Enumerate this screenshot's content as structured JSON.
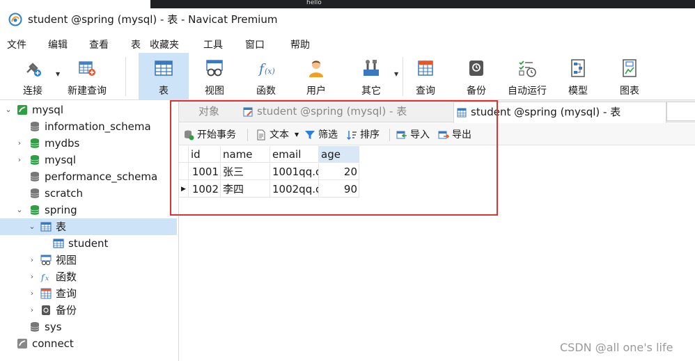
{
  "window": {
    "title": "student @spring (mysql) - 表 - Navicat Premium",
    "background_tab": "hello"
  },
  "menu": [
    "文件",
    "编辑",
    "查看",
    "表",
    "收藏夹",
    "工具",
    "窗口",
    "帮助"
  ],
  "toolbar": [
    {
      "label": "连接",
      "icon": "connection-plug-icon"
    },
    {
      "label": "新建查询",
      "icon": "new-query-icon"
    },
    {
      "label": "表",
      "icon": "table-icon",
      "active": true
    },
    {
      "label": "视图",
      "icon": "view-icon"
    },
    {
      "label": "函数",
      "icon": "function-icon"
    },
    {
      "label": "用户",
      "icon": "user-icon"
    },
    {
      "label": "其它",
      "icon": "tools-icon"
    },
    {
      "label": "查询",
      "icon": "query-icon"
    },
    {
      "label": "备份",
      "icon": "backup-icon"
    },
    {
      "label": "自动运行",
      "icon": "automation-icon"
    },
    {
      "label": "模型",
      "icon": "model-icon"
    },
    {
      "label": "图表",
      "icon": "chart-icon"
    }
  ],
  "tree": [
    {
      "label": "mysql",
      "icon": "connection-icon",
      "expanded": true
    },
    {
      "label": "information_schema",
      "icon": "database-icon"
    },
    {
      "label": "mydbs",
      "icon": "database-icon"
    },
    {
      "label": "mysql",
      "icon": "database-icon"
    },
    {
      "label": "performance_schema",
      "icon": "database-icon"
    },
    {
      "label": "scratch",
      "icon": "database-icon"
    },
    {
      "label": "spring",
      "icon": "database-icon",
      "expanded": true
    },
    {
      "label": "表",
      "icon": "table-icon",
      "expanded": true,
      "selected": true
    },
    {
      "label": "student",
      "icon": "table-icon"
    },
    {
      "label": "视图",
      "icon": "view-icon"
    },
    {
      "label": "函数",
      "icon": "function-icon"
    },
    {
      "label": "查询",
      "icon": "query-icon"
    },
    {
      "label": "备份",
      "icon": "backup-icon"
    },
    {
      "label": "sys",
      "icon": "database-icon"
    },
    {
      "label": "connect",
      "icon": "connection-icon"
    }
  ],
  "tabs": [
    {
      "label": "对象"
    },
    {
      "label": "student @spring (mysql) - 表"
    },
    {
      "label": "student @spring (mysql) - 表",
      "active": true
    }
  ],
  "object_toolbar": {
    "begin_transaction": "开始事务",
    "text": "文本",
    "filter": "筛选",
    "sort": "排序",
    "import": "导入",
    "export": "导出"
  },
  "grid": {
    "columns": [
      "id",
      "name",
      "email",
      "age"
    ],
    "rows": [
      [
        "1001",
        "张三",
        "1001qq.c",
        "20"
      ],
      [
        "1002",
        "李四",
        "1002qq.c",
        "90"
      ]
    ],
    "selected_column": "age",
    "current_row_marker": "▶"
  },
  "watermark": "CSDN @all one's life",
  "colors": {
    "selection": "#cde3f7",
    "highlight_box": "#e0322f",
    "db_green": "#2ea043"
  }
}
